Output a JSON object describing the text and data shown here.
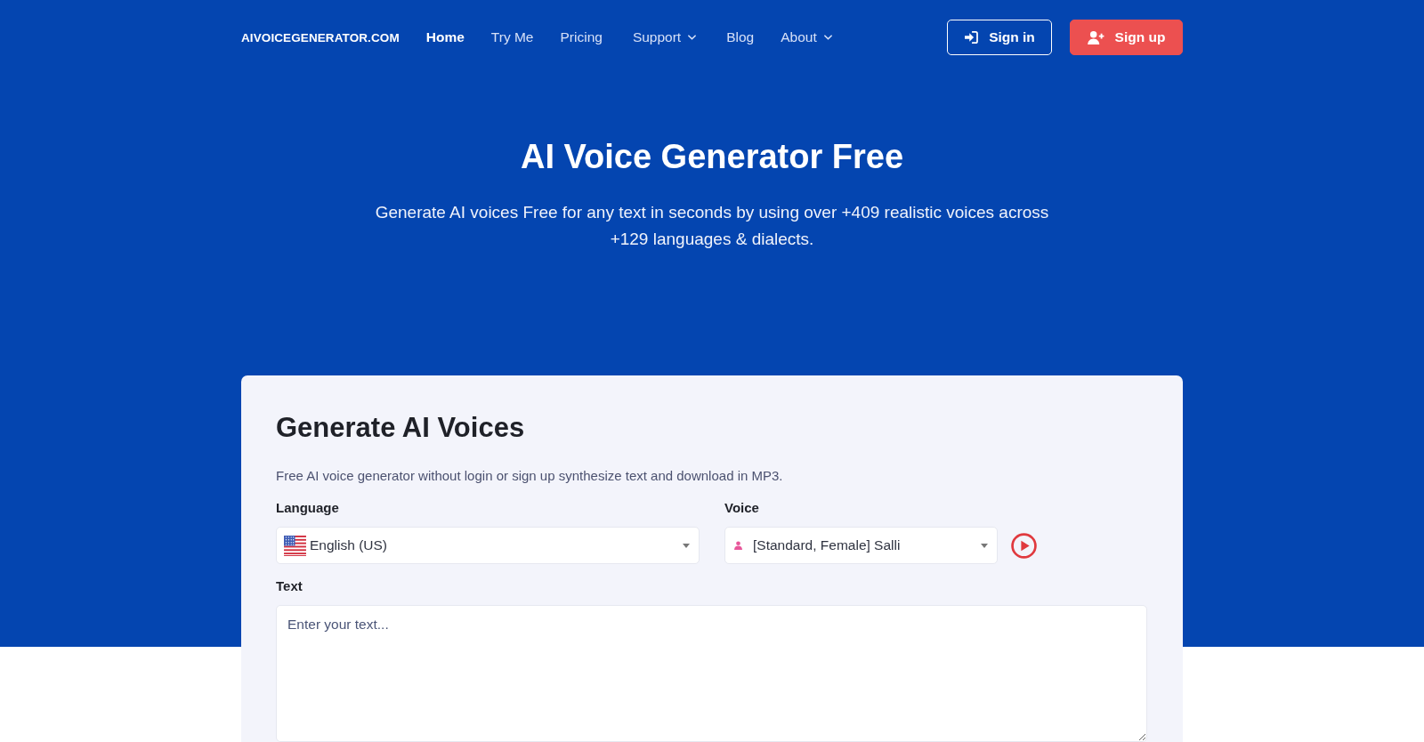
{
  "nav": {
    "logo": "AIVOICEGENERATOR.COM",
    "items": [
      {
        "label": "Home",
        "selected": true,
        "dropdown": false
      },
      {
        "label": "Try Me",
        "selected": false,
        "dropdown": false
      },
      {
        "label": "Pricing",
        "selected": false,
        "dropdown": false
      },
      {
        "label": "Support",
        "selected": false,
        "dropdown": true
      },
      {
        "label": "Blog",
        "selected": false,
        "dropdown": false
      },
      {
        "label": "About",
        "selected": false,
        "dropdown": true
      }
    ]
  },
  "auth_buttons": [
    {
      "label": "Sign in",
      "kind": "outline"
    },
    {
      "label": "Sign up",
      "kind": "filled"
    }
  ],
  "hero": {
    "title": "AI Voice Generator Free",
    "subtitle": "Generate AI voices Free for any text in seconds by using over +409 realistic voices across +129 languages & dialects."
  },
  "card": {
    "heading": "Generate AI Voices",
    "description": "Free AI voice generator without login or sign up synthesize text and download in MP3.",
    "language": {
      "label": "Language",
      "value": "English (US)"
    },
    "voice": {
      "label": "Voice",
      "value": "[Standard, Female] Salli"
    },
    "text": {
      "label": "Text",
      "placeholder": "Enter your text..."
    }
  }
}
